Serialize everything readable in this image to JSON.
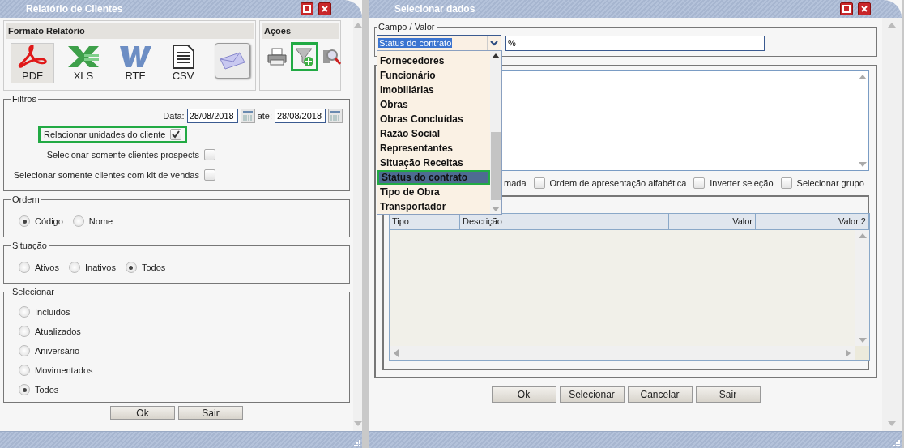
{
  "left_window": {
    "title": "Relatório de Clientes",
    "format_panel": {
      "title": "Formato Relatório",
      "formats": [
        {
          "label": "PDF",
          "kind": "pdf",
          "selected": true
        },
        {
          "label": "XLS",
          "kind": "xls",
          "selected": false
        },
        {
          "label": "RTF",
          "kind": "rtf",
          "selected": false
        },
        {
          "label": "CSV",
          "kind": "csv",
          "selected": false
        },
        {
          "kind": "email"
        }
      ]
    },
    "actions_panel": {
      "title": "Ações",
      "actions": [
        {
          "kind": "print",
          "highlighted": false
        },
        {
          "kind": "filter-add",
          "highlighted": true
        },
        {
          "kind": "search",
          "highlighted": false
        }
      ]
    },
    "filters": {
      "legend": "Filtros",
      "date_label": "Data:",
      "date_from": "28/08/2018",
      "until_label": "até:",
      "date_to": "28/08/2018",
      "checks": [
        {
          "label": "Relacionar unidades do cliente",
          "checked": true,
          "highlighted": true
        },
        {
          "label": "Selecionar somente clientes prospects",
          "checked": false,
          "highlighted": false
        },
        {
          "label": "Selecionar somente clientes com kit de vendas",
          "checked": false,
          "highlighted": false
        }
      ]
    },
    "groups": [
      {
        "legend": "Ordem",
        "options": [
          {
            "label": "Código",
            "selected": true
          },
          {
            "label": "Nome",
            "selected": false
          }
        ]
      },
      {
        "legend": "Situação",
        "options": [
          {
            "label": "Ativos",
            "selected": false
          },
          {
            "label": "Inativos",
            "selected": false
          },
          {
            "label": "Todos",
            "selected": true
          }
        ]
      },
      {
        "legend": "Selecionar",
        "options": [
          {
            "label": "Incluidos",
            "selected": false
          },
          {
            "label": "Atualizados",
            "selected": false
          },
          {
            "label": "Aniversário",
            "selected": false
          },
          {
            "label": "Movimentados",
            "selected": false
          },
          {
            "label": "Todos",
            "selected": true
          }
        ]
      }
    ],
    "buttons": [
      "Ok",
      "Sair"
    ]
  },
  "right_window": {
    "title": "Selecionar dados",
    "field_value": {
      "legend": "Campo / Valor",
      "field": "Status do contrato",
      "value": "%",
      "dropdown": [
        {
          "label": "Fornecedores",
          "selected": false
        },
        {
          "label": "Funcionário",
          "selected": false
        },
        {
          "label": "Imobiliárias",
          "selected": false
        },
        {
          "label": "Obras",
          "selected": false
        },
        {
          "label": "Obras Concluídas",
          "selected": false
        },
        {
          "label": "Razão Social",
          "selected": false
        },
        {
          "label": "Representantes",
          "selected": false
        },
        {
          "label": "Situação Receitas",
          "selected": false
        },
        {
          "label": "Status do contrato",
          "selected": true
        },
        {
          "label": "Tipo de Obra",
          "selected": false
        },
        {
          "label": "Transportador",
          "selected": false
        }
      ]
    },
    "options": [
      {
        "kind": "text",
        "label": "mada"
      },
      {
        "kind": "checkbox",
        "label": "Ordem de apresentação alfabética",
        "checked": false
      },
      {
        "kind": "checkbox",
        "label": "Inverter seleção",
        "checked": false
      },
      {
        "kind": "checkbox",
        "label": "Selecionar grupo",
        "checked": false
      }
    ],
    "table": {
      "columns": [
        "Tipo",
        "Descrição",
        "Valor",
        "Valor 2"
      ]
    },
    "buttons": [
      "Ok",
      "Selecionar",
      "Cancelar",
      "Sair"
    ]
  }
}
